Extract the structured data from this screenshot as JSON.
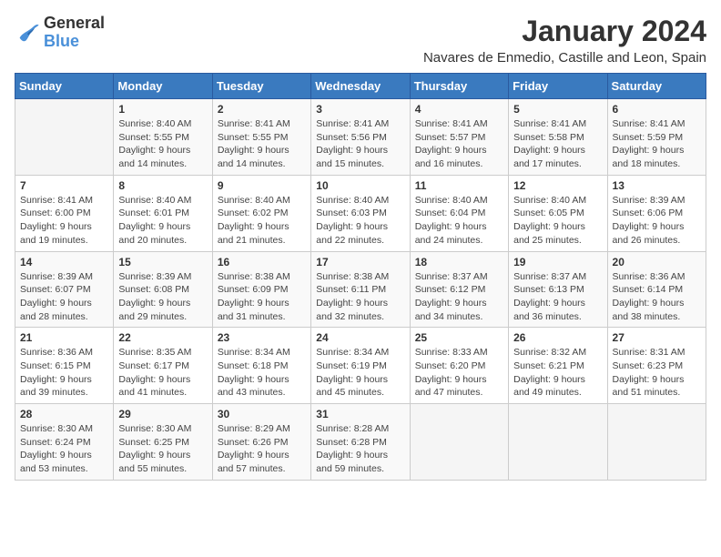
{
  "header": {
    "logo_general": "General",
    "logo_blue": "Blue",
    "month_title": "January 2024",
    "location": "Navares de Enmedio, Castille and Leon, Spain"
  },
  "weekdays": [
    "Sunday",
    "Monday",
    "Tuesday",
    "Wednesday",
    "Thursday",
    "Friday",
    "Saturday"
  ],
  "weeks": [
    [
      {
        "day": "",
        "content": ""
      },
      {
        "day": "1",
        "content": "Sunrise: 8:40 AM\nSunset: 5:55 PM\nDaylight: 9 hours\nand 14 minutes."
      },
      {
        "day": "2",
        "content": "Sunrise: 8:41 AM\nSunset: 5:55 PM\nDaylight: 9 hours\nand 14 minutes."
      },
      {
        "day": "3",
        "content": "Sunrise: 8:41 AM\nSunset: 5:56 PM\nDaylight: 9 hours\nand 15 minutes."
      },
      {
        "day": "4",
        "content": "Sunrise: 8:41 AM\nSunset: 5:57 PM\nDaylight: 9 hours\nand 16 minutes."
      },
      {
        "day": "5",
        "content": "Sunrise: 8:41 AM\nSunset: 5:58 PM\nDaylight: 9 hours\nand 17 minutes."
      },
      {
        "day": "6",
        "content": "Sunrise: 8:41 AM\nSunset: 5:59 PM\nDaylight: 9 hours\nand 18 minutes."
      }
    ],
    [
      {
        "day": "7",
        "content": "Sunrise: 8:41 AM\nSunset: 6:00 PM\nDaylight: 9 hours\nand 19 minutes."
      },
      {
        "day": "8",
        "content": "Sunrise: 8:40 AM\nSunset: 6:01 PM\nDaylight: 9 hours\nand 20 minutes."
      },
      {
        "day": "9",
        "content": "Sunrise: 8:40 AM\nSunset: 6:02 PM\nDaylight: 9 hours\nand 21 minutes."
      },
      {
        "day": "10",
        "content": "Sunrise: 8:40 AM\nSunset: 6:03 PM\nDaylight: 9 hours\nand 22 minutes."
      },
      {
        "day": "11",
        "content": "Sunrise: 8:40 AM\nSunset: 6:04 PM\nDaylight: 9 hours\nand 24 minutes."
      },
      {
        "day": "12",
        "content": "Sunrise: 8:40 AM\nSunset: 6:05 PM\nDaylight: 9 hours\nand 25 minutes."
      },
      {
        "day": "13",
        "content": "Sunrise: 8:39 AM\nSunset: 6:06 PM\nDaylight: 9 hours\nand 26 minutes."
      }
    ],
    [
      {
        "day": "14",
        "content": "Sunrise: 8:39 AM\nSunset: 6:07 PM\nDaylight: 9 hours\nand 28 minutes."
      },
      {
        "day": "15",
        "content": "Sunrise: 8:39 AM\nSunset: 6:08 PM\nDaylight: 9 hours\nand 29 minutes."
      },
      {
        "day": "16",
        "content": "Sunrise: 8:38 AM\nSunset: 6:09 PM\nDaylight: 9 hours\nand 31 minutes."
      },
      {
        "day": "17",
        "content": "Sunrise: 8:38 AM\nSunset: 6:11 PM\nDaylight: 9 hours\nand 32 minutes."
      },
      {
        "day": "18",
        "content": "Sunrise: 8:37 AM\nSunset: 6:12 PM\nDaylight: 9 hours\nand 34 minutes."
      },
      {
        "day": "19",
        "content": "Sunrise: 8:37 AM\nSunset: 6:13 PM\nDaylight: 9 hours\nand 36 minutes."
      },
      {
        "day": "20",
        "content": "Sunrise: 8:36 AM\nSunset: 6:14 PM\nDaylight: 9 hours\nand 38 minutes."
      }
    ],
    [
      {
        "day": "21",
        "content": "Sunrise: 8:36 AM\nSunset: 6:15 PM\nDaylight: 9 hours\nand 39 minutes."
      },
      {
        "day": "22",
        "content": "Sunrise: 8:35 AM\nSunset: 6:17 PM\nDaylight: 9 hours\nand 41 minutes."
      },
      {
        "day": "23",
        "content": "Sunrise: 8:34 AM\nSunset: 6:18 PM\nDaylight: 9 hours\nand 43 minutes."
      },
      {
        "day": "24",
        "content": "Sunrise: 8:34 AM\nSunset: 6:19 PM\nDaylight: 9 hours\nand 45 minutes."
      },
      {
        "day": "25",
        "content": "Sunrise: 8:33 AM\nSunset: 6:20 PM\nDaylight: 9 hours\nand 47 minutes."
      },
      {
        "day": "26",
        "content": "Sunrise: 8:32 AM\nSunset: 6:21 PM\nDaylight: 9 hours\nand 49 minutes."
      },
      {
        "day": "27",
        "content": "Sunrise: 8:31 AM\nSunset: 6:23 PM\nDaylight: 9 hours\nand 51 minutes."
      }
    ],
    [
      {
        "day": "28",
        "content": "Sunrise: 8:30 AM\nSunset: 6:24 PM\nDaylight: 9 hours\nand 53 minutes."
      },
      {
        "day": "29",
        "content": "Sunrise: 8:30 AM\nSunset: 6:25 PM\nDaylight: 9 hours\nand 55 minutes."
      },
      {
        "day": "30",
        "content": "Sunrise: 8:29 AM\nSunset: 6:26 PM\nDaylight: 9 hours\nand 57 minutes."
      },
      {
        "day": "31",
        "content": "Sunrise: 8:28 AM\nSunset: 6:28 PM\nDaylight: 9 hours\nand 59 minutes."
      },
      {
        "day": "",
        "content": ""
      },
      {
        "day": "",
        "content": ""
      },
      {
        "day": "",
        "content": ""
      }
    ]
  ]
}
